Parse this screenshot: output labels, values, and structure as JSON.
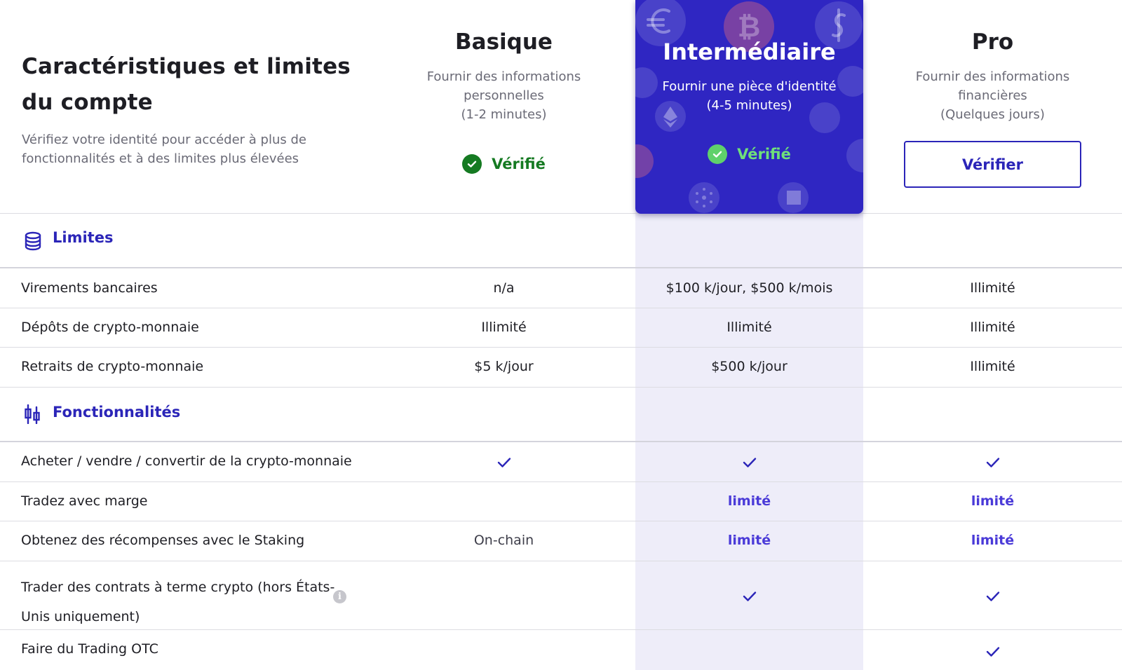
{
  "intro": {
    "title": "Caractéristiques et limites du compte",
    "subtitle": "Vérifiez votre identité pour accéder à plus de fonctionnalités et à des limites plus élevées"
  },
  "tiers": {
    "basic": {
      "name": "Basique",
      "desc_1": "Fournir des informations",
      "desc_2": "personnelles",
      "desc_3": "(1-2 minutes)",
      "status": "Vérifié"
    },
    "mid": {
      "name": "Intermédiaire",
      "desc_1": "Fournir une pièce d'identité",
      "desc_2": "(4-5 minutes)",
      "status": "Vérifié"
    },
    "pro": {
      "name": "Pro",
      "desc_1": "Fournir des informations",
      "desc_2": "financières",
      "desc_3": "(Quelques jours)",
      "button": "Vérifier"
    }
  },
  "sections": {
    "limits": {
      "title": "Limites",
      "icon": "coin-stack-icon"
    },
    "features": {
      "title": "Fonctionnalités",
      "icon": "candlestick-chart-icon"
    }
  },
  "limits_rows": [
    {
      "label": "Virements bancaires",
      "basic": "n/a",
      "mid": "$100 k/jour, $500 k/mois",
      "pro": "Illimité"
    },
    {
      "label": "Dépôts de crypto-monnaie",
      "basic": "Illimité",
      "mid": "Illimité",
      "pro": "Illimité"
    },
    {
      "label": "Retraits de crypto-monnaie",
      "basic": "$5 k/jour",
      "mid": "$500 k/jour",
      "pro": "Illimité"
    }
  ],
  "feature_rows": [
    {
      "label": "Acheter / vendre / convertir de la crypto-monnaie",
      "basic": "check",
      "mid": "check",
      "pro": "check"
    },
    {
      "label": "Tradez avec marge",
      "basic": "",
      "mid": "limité",
      "pro": "limité"
    },
    {
      "label": "Obtenez des récompenses avec le Staking",
      "basic": "On-chain",
      "mid": "limité",
      "pro": "limité"
    },
    {
      "label_1": "Trader des contrats à terme crypto (hors États-",
      "label_2": "Unis uniquement)",
      "info": "i",
      "basic": "",
      "mid": "check",
      "pro": "check"
    },
    {
      "label": "Faire du Trading OTC",
      "basic": "",
      "mid": "",
      "pro": "check"
    }
  ],
  "colors": {
    "accent": "#2b25b8",
    "highlight_column": "#eeedf9",
    "intermediate_card": "#2f26c2",
    "verified_green": "#157a22",
    "limited_purple": "#4a3ad8"
  }
}
